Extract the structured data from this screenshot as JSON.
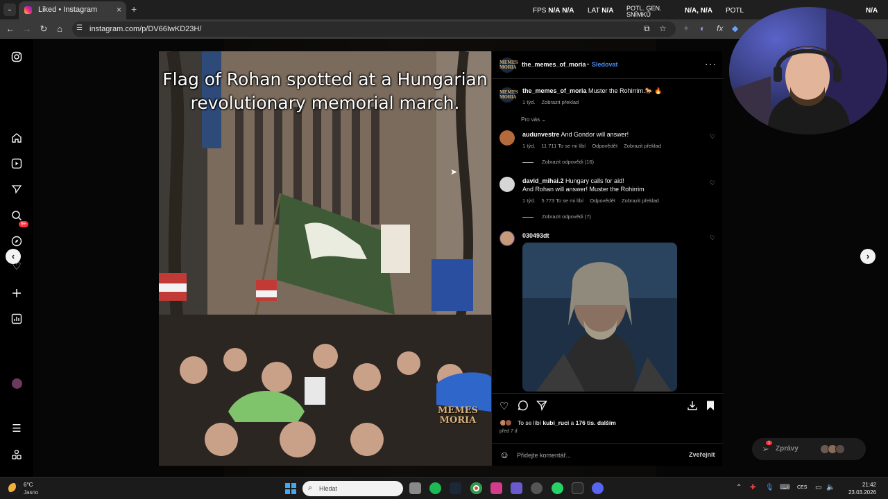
{
  "browser": {
    "tab_title": "Liked • Instagram",
    "tab_close": "×",
    "new_tab": "+",
    "url": "instagram.com/p/DV66IwKD23H/"
  },
  "overlay": {
    "fps_label": "FPS",
    "fps_value_1": "N/A",
    "fps_value_2": "N/A",
    "lat_label": "LAT",
    "lat_value": "N/A",
    "potl_line1": "POTL. GEN.",
    "potl_line2": "SNÍMKŮ",
    "potl_values": "N/A, N/A",
    "potl_short": "POTL",
    "right_value": "N/A"
  },
  "sidebar": {
    "notification_badge": "9+"
  },
  "post": {
    "caption_line1": "Flag of Rohan spotted at a Hungarian",
    "caption_line2": "revolutionary memorial march.",
    "watermark_line1": "MEMES",
    "watermark_line2": "MORIA",
    "author": "the_memes_of_moria",
    "separator": "•",
    "follow": "Sledovat",
    "more": "···",
    "description_author": "the_memes_of_moria",
    "description_text": " Muster the Rohirrim.🐎 🔥",
    "description_age": "1 týd.",
    "description_translate": "Zobrazit překlad",
    "for_you": "Pro vás ⌄",
    "comments": [
      {
        "author": "audunvestre",
        "text": " And Gondor will answer!",
        "age": "1 týd.",
        "likes": "11 711 To se mi líbí",
        "reply": "Odpovědět",
        "translate": "Zobrazit překlad",
        "view_replies": "Zobrazit odpovědi (16)"
      },
      {
        "author": "david_mihai.2",
        "text": " Hungary calls for aid!",
        "text_line2": "And Rohan will answer! Muster the Rohirrim",
        "age": "1 týd.",
        "likes": "5 773 To se mi líbí",
        "reply": "Odpovědět",
        "translate": "Zobrazit překlad",
        "view_replies": "Zobrazit odpovědi (7)"
      },
      {
        "author": "030493dt"
      }
    ],
    "likes_prefix": "To se líbí ",
    "likes_user": "kubi_ruci",
    "likes_mid": " a ",
    "likes_count": "176 tis. dalším",
    "posted_ago": "před 7 d",
    "comment_placeholder": "Přidejte komentář...",
    "post_button": "Zveřejnit"
  },
  "messages": {
    "label": "Zprávy",
    "badge": "1"
  },
  "taskbar": {
    "temperature": "6°C",
    "weather": "Jasno",
    "search_placeholder": "Hledat",
    "language": "CES",
    "time": "21:42",
    "date": "23.03.2026"
  },
  "icons": {
    "instagram": "instagram-icon",
    "home": "home-icon",
    "reels": "reels-icon",
    "explore": "explore-icon",
    "search": "search-icon",
    "notifications": "heart-icon",
    "create": "plus-icon",
    "dashboard": "dashboard-icon",
    "menu": "menu-icon",
    "meta": "meta-icon"
  },
  "colors": {
    "accent_blue": "#4a8ff7",
    "badge_red": "#ff3040",
    "panel_bg": "#000000"
  }
}
